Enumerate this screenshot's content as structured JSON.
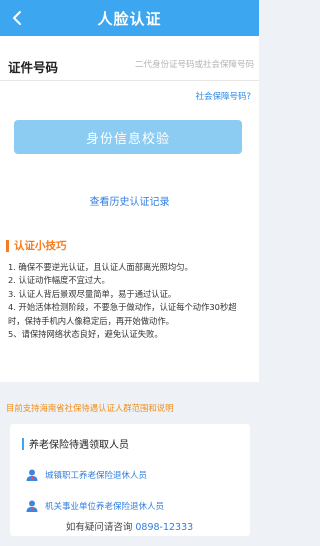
{
  "header": {
    "title": "人脸认证",
    "back_icon": "chevron-left-icon"
  },
  "form": {
    "id_label": "证件号码",
    "id_placeholder": "二代身份证号码或社会保障号码",
    "id_value": "",
    "social_security_link": "社会保障号码?",
    "verify_button": "身份信息校验",
    "history_link": "查看历史认证记录"
  },
  "tips": {
    "title": "认证小技巧",
    "items": [
      "1. 确保不要逆光认证，且认证人面部离光照均匀。",
      "2. 认证动作幅度不宜过大。",
      "3. 认证人背后景观尽量简单，易于通过认证。",
      "4. 开始活体检测阶段，不要急于做动作，认证每个动作30秒超时，保持手机内人像稳定后，再开始做动作。",
      "5、请保持网络状态良好，避免认证失败。"
    ]
  },
  "support_notice": "目前支持海南省社保待遇认证人群范围和说明",
  "pension": {
    "title": "养老保险待遇领取人员",
    "items": [
      {
        "label": "城镇职工养老保险退休人员",
        "icon": "person-icon"
      },
      {
        "label": "机关事业单位养老保险退休人员",
        "icon": "person-icon"
      }
    ]
  },
  "hotline": {
    "prefix": "如有疑问请咨询",
    "number": "0898-12333"
  },
  "colors": {
    "brand_blue": "#3da6f0",
    "button_disabled": "#8ccbf2",
    "link_blue": "#2f7de0",
    "accent_orange": "#f57c1f"
  }
}
